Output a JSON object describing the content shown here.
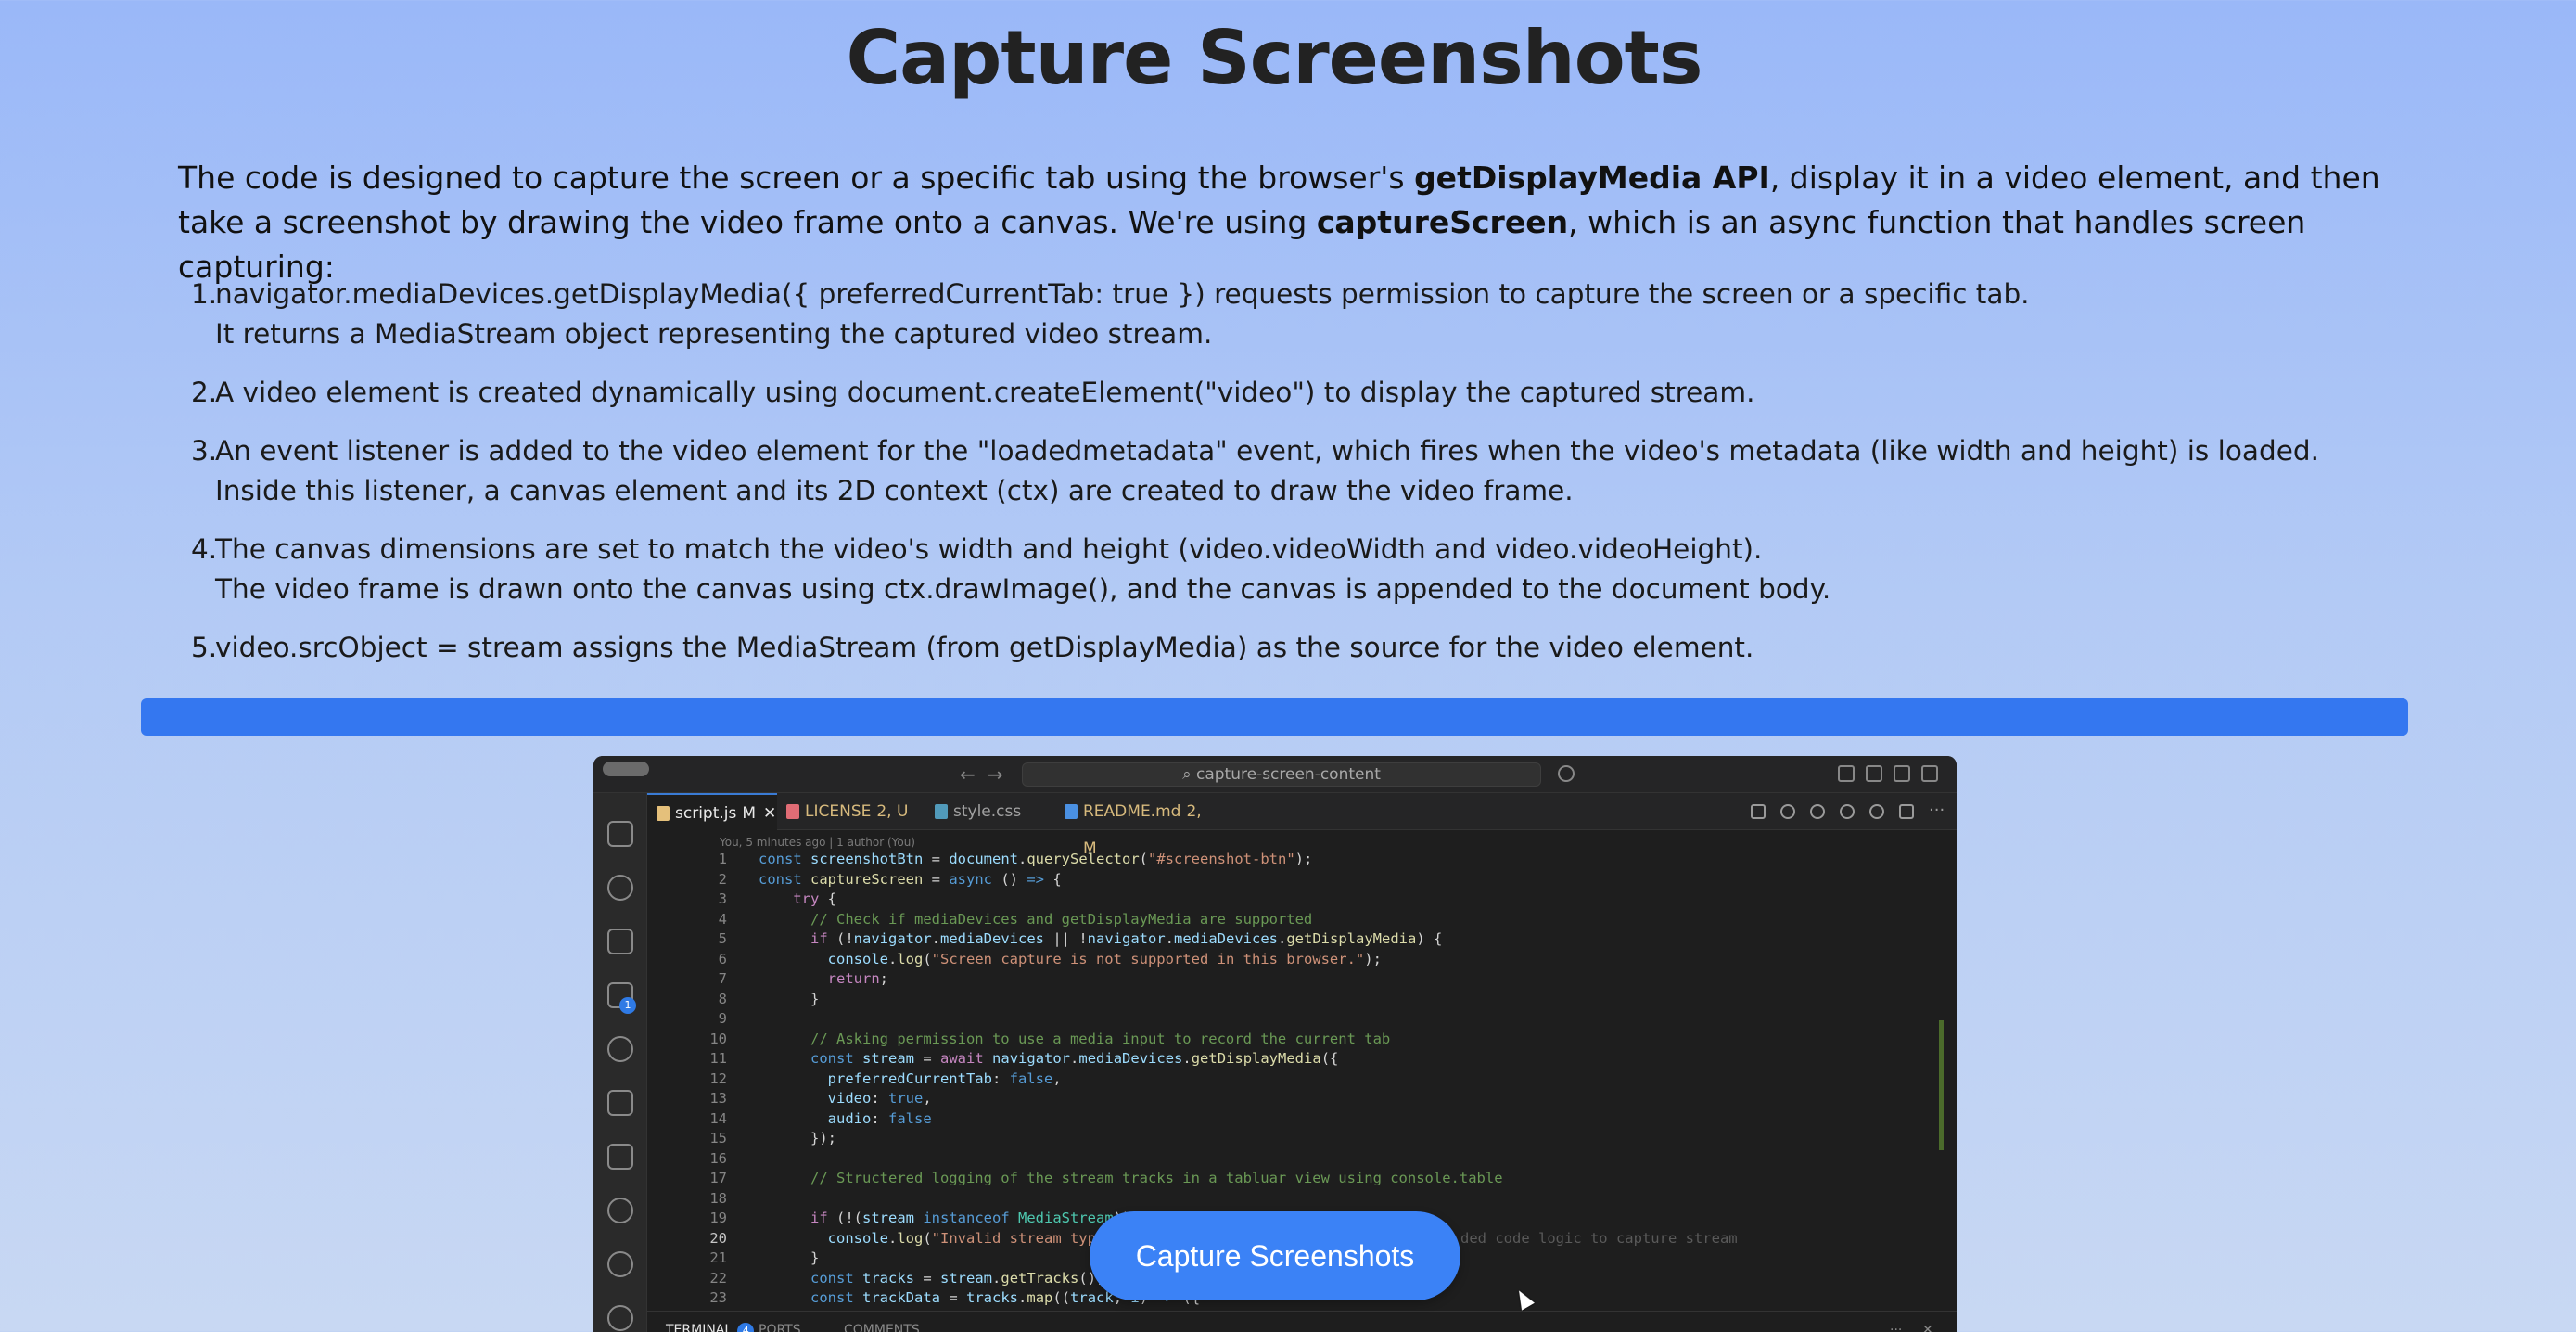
{
  "page": {
    "title": "Capture Screenshots",
    "intro_1": "The code is designed to capture the screen or a specific tab using the browser's ",
    "intro_bold_1": "getDisplayMedia API",
    "intro_2": ", display it in a video element, and then take a screenshot by drawing the video frame onto a canvas. We're using ",
    "intro_bold_2": "captureScreen",
    "intro_3": ", which is an async function that handles screen capturing:",
    "steps": [
      {
        "num": "1.",
        "lines": [
          "navigator.mediaDevices.getDisplayMedia({ preferredCurrentTab: true }) requests permission to capture the screen or a specific tab.",
          "It returns a MediaStream object representing the captured video stream."
        ]
      },
      {
        "num": "2.",
        "lines": [
          "A video element is created dynamically using document.createElement(\"video\") to display the captured stream."
        ]
      },
      {
        "num": "3.",
        "lines": [
          "An event listener is added to the video element for the \"loadedmetadata\" event, which fires when the video's metadata (like width and height) is loaded.",
          "Inside this listener, a canvas element and its 2D context (ctx) are created to draw the video frame."
        ]
      },
      {
        "num": "4.",
        "lines": [
          "The canvas dimensions are set to match the video's width and height (video.videoWidth and video.videoHeight).",
          "The video frame is drawn onto the canvas using ctx.drawImage(), and the canvas is appended to the document body."
        ]
      },
      {
        "num": "5.",
        "lines": [
          "video.srcObject = stream assigns the MediaStream (from getDisplayMedia) as the source for the video element."
        ]
      }
    ],
    "capture_button_label": "Capture Screenshots"
  },
  "editor": {
    "search_text": "⌕ capture-screen-content",
    "tabs": [
      {
        "label": "script.js",
        "status": "M",
        "icon_color": "#e5c07b",
        "text_color": "#e8e8e8",
        "active": true,
        "close": "✕"
      },
      {
        "label": "LICENSE",
        "status": "2, U",
        "icon_color": "#e06c75",
        "text_color": "#d7ba7d",
        "active": false
      },
      {
        "label": "style.css",
        "status": "",
        "icon_color": "#519aba",
        "text_color": "#a0a0a0",
        "active": false
      },
      {
        "label": "README.md",
        "status": "2, M",
        "icon_color": "#4a90e2",
        "text_color": "#d7ba7d",
        "active": false
      }
    ],
    "blame": "You, 5 minutes ago | 1 author (You)",
    "ghost_text": "ded code logic to capture stream",
    "activity_badge": "1",
    "terminal": {
      "terminal": "TERMINAL",
      "badge": "4",
      "ports": "PORTS",
      "comments": "COMMENTS",
      "more": "···",
      "close": "✕"
    }
  }
}
